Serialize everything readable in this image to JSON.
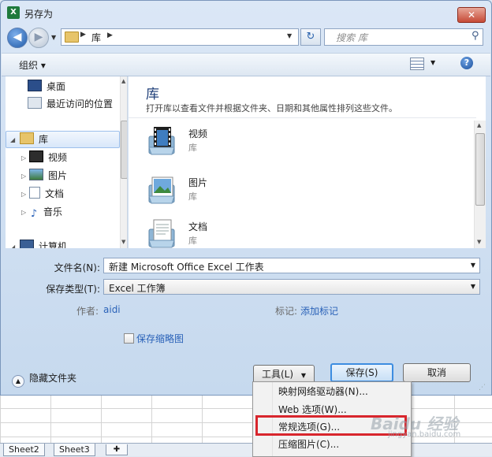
{
  "window": {
    "title": "另存为",
    "app_icon": "excel-icon",
    "close_label": "✕"
  },
  "nav": {
    "address_label": "库",
    "search_placeholder": "搜索 库"
  },
  "toolbar": {
    "organize_label": "组织 ▾"
  },
  "sidebar": {
    "items": [
      {
        "label": "桌面",
        "icon": "desktop-icon"
      },
      {
        "label": "最近访问的位置",
        "icon": "recent-places-icon"
      },
      {
        "label": "库",
        "icon": "library-icon",
        "selected": true
      },
      {
        "label": "视频",
        "icon": "video-icon"
      },
      {
        "label": "图片",
        "icon": "picture-icon"
      },
      {
        "label": "文档",
        "icon": "document-icon"
      },
      {
        "label": "音乐",
        "icon": "music-icon"
      },
      {
        "label": "计算机",
        "icon": "computer-icon"
      }
    ]
  },
  "content": {
    "title": "库",
    "description": "打开库以查看文件并根据文件夹、日期和其他属性排列这些文件。",
    "items": [
      {
        "name": "视频",
        "type": "库",
        "icon": "video-library-icon"
      },
      {
        "name": "图片",
        "type": "库",
        "icon": "picture-library-icon"
      },
      {
        "name": "文档",
        "type": "库",
        "icon": "document-library-icon"
      }
    ]
  },
  "form": {
    "filename_label": "文件名(N):",
    "filename_value": "新建 Microsoft Office Excel 工作表",
    "filetype_label": "保存类型(T):",
    "filetype_value": "Excel 工作簿",
    "author_label": "作者:",
    "author_value": "aidi",
    "tags_label": "标记:",
    "tags_value": "添加标记",
    "thumbnail_label": "保存缩略图"
  },
  "buttons": {
    "hide_folders": "隐藏文件夹",
    "tools": "工具(L)",
    "save": "保存(S)",
    "cancel": "取消"
  },
  "tools_menu": {
    "items": [
      "映射网络驱动器(N)...",
      "Web 选项(W)...",
      "常规选项(G)...",
      "压缩图片(C)..."
    ]
  },
  "excel": {
    "sheet_tabs": [
      "Sheet2",
      "Sheet3"
    ]
  },
  "watermark": {
    "text": "Baidu 经验",
    "sub": "jingyan.baidu.com"
  },
  "colors": {
    "accent": "#3d8de0",
    "link": "#2a62b8",
    "highlight_border": "#d8262d",
    "selection": "#d8e7fa"
  }
}
